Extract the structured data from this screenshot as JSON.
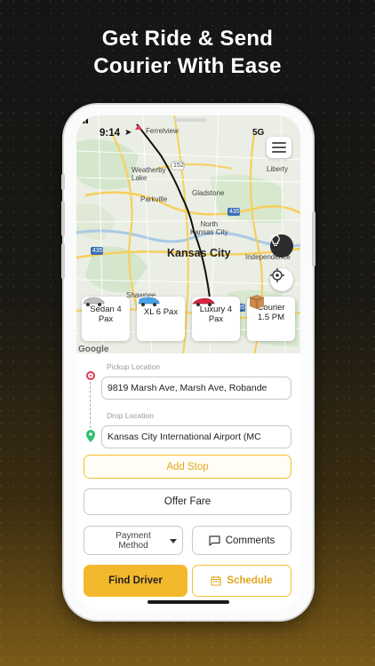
{
  "headline": {
    "line1": "Get Ride & Send",
    "line2": "Courier With Ease"
  },
  "status_bar": {
    "time": "9:14",
    "network": "5G"
  },
  "map": {
    "labels": {
      "ferrelview": "Ferrelview",
      "weatherby_lake": "Weatherby\nLake",
      "parkville": "Parkville",
      "gladstone": "Gladstone",
      "liberty": "Liberty",
      "north_kansas_city": "North\nKansas City",
      "kansas_city": "Kansas City",
      "independence": "Independence",
      "shawnee": "Shawnee",
      "route_152": "152",
      "route_435": "435",
      "route_435b": "435",
      "route_435c": "435"
    },
    "attribution": "Google"
  },
  "vehicles": [
    {
      "label": "Sedan 4\nPax",
      "icon": "sedan-car-icon"
    },
    {
      "label": "XL 6 Pax",
      "icon": "xl-car-icon"
    },
    {
      "label": "Luxury 4\nPax",
      "icon": "luxury-car-icon"
    },
    {
      "label": "Courier\n1.5 PM",
      "icon": "courier-box-icon"
    }
  ],
  "pickup": {
    "label": "Pickup Location",
    "value": "9819 Marsh Ave, Marsh Ave, Robande"
  },
  "drop": {
    "label": "Drop Location",
    "value": "Kansas City International Airport (MC"
  },
  "buttons": {
    "add_stop": "Add Stop",
    "offer_fare": "Offer Fare",
    "payment_line1": "Payment",
    "payment_line2": "Method",
    "comments": "Comments",
    "find_driver": "Find Driver",
    "schedule": "Schedule"
  },
  "colors": {
    "accent": "#f4b82c",
    "pickup": "#e53950",
    "drop": "#2fbf71"
  }
}
